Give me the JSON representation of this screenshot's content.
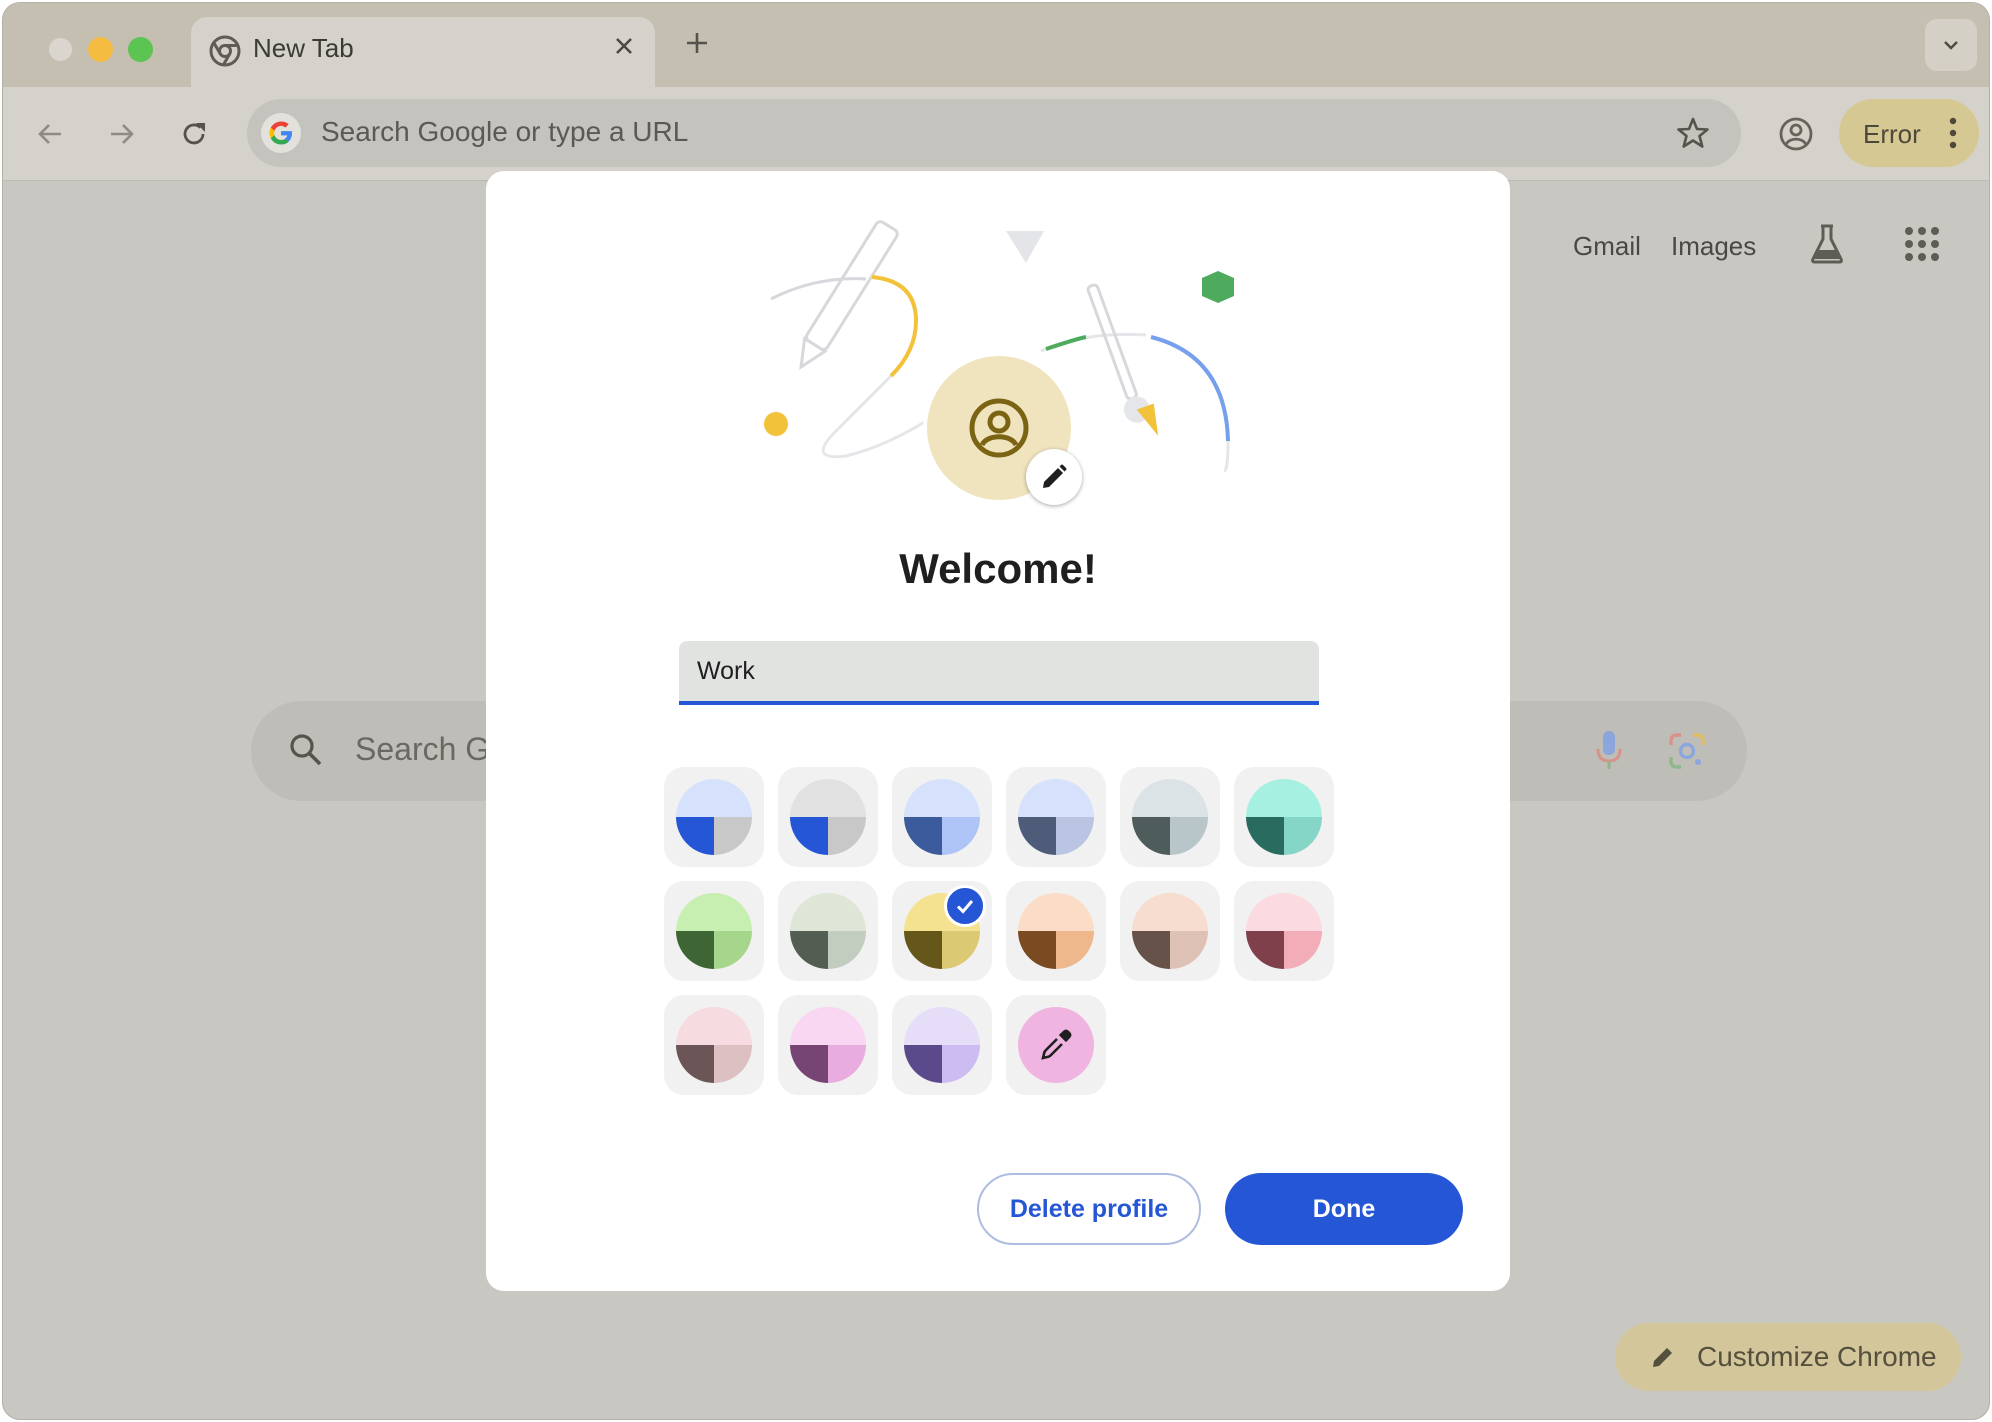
{
  "window": {
    "tab_title": "New Tab",
    "omnibox_placeholder": "Search Google or type a URL",
    "error_label": "Error"
  },
  "ntp": {
    "links": [
      "Gmail",
      "Images"
    ],
    "search_placeholder": "Search G",
    "customize_label": "Customize Chrome"
  },
  "dialog": {
    "title": "Welcome!",
    "profile_name": "Work",
    "delete_label": "Delete profile",
    "done_label": "Done",
    "selected_theme_index": 8,
    "themes": [
      {
        "name": "blue-grey",
        "top": "#d6e2fb",
        "bl": "#2456d6",
        "br": "#c8c8c8"
      },
      {
        "name": "grey",
        "top": "#e1e1e1",
        "bl": "#2456d6",
        "br": "#c8c8c8"
      },
      {
        "name": "light-blue",
        "top": "#d6e2fb",
        "bl": "#3b5b9c",
        "br": "#aec4f6"
      },
      {
        "name": "slate",
        "top": "#d6e2fb",
        "bl": "#4f5c79",
        "br": "#bac5e3"
      },
      {
        "name": "cool-grey",
        "top": "#dbe3e6",
        "bl": "#4f5c5c",
        "br": "#b8c6ca"
      },
      {
        "name": "aqua",
        "top": "#a5f0e0",
        "bl": "#2a6b60",
        "br": "#86d6c8"
      },
      {
        "name": "green",
        "top": "#c6efb1",
        "bl": "#3d6634",
        "br": "#a6d68c"
      },
      {
        "name": "olive-grey",
        "top": "#dfe6d8",
        "bl": "#545d52",
        "br": "#c2ccbf"
      },
      {
        "name": "yellow",
        "top": "#f5e290",
        "bl": "#655719",
        "br": "#dbca73"
      },
      {
        "name": "orange",
        "top": "#fbdcc6",
        "bl": "#7a4a20",
        "br": "#efb78c"
      },
      {
        "name": "beige",
        "top": "#f6ddcf",
        "bl": "#665249",
        "br": "#dcc1b4"
      },
      {
        "name": "rose",
        "top": "#fbdbe0",
        "bl": "#7f3f4b",
        "br": "#f2adb8"
      },
      {
        "name": "mauve",
        "top": "#f6dce0",
        "bl": "#6b5557",
        "br": "#dcc0c2"
      },
      {
        "name": "pink",
        "top": "#f9d6f1",
        "bl": "#764574",
        "br": "#e9ace1"
      },
      {
        "name": "lavender",
        "top": "#e6ddf9",
        "bl": "#5a4a8c",
        "br": "#ccbcf2"
      }
    ],
    "custom_color_icon": "eyedropper-icon"
  },
  "colors": {
    "accent": "#2456d6",
    "avatar_bg": "#f0e4bf",
    "avatar_icon": "#7a6414"
  }
}
